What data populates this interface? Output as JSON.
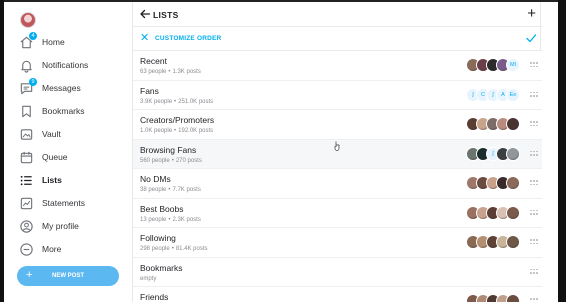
{
  "sidebar": {
    "items": [
      {
        "label": "Home",
        "icon": "home-icon",
        "badge": "4"
      },
      {
        "label": "Notifications",
        "icon": "bell-icon",
        "badge": ""
      },
      {
        "label": "Messages",
        "icon": "chat-icon",
        "badge": "9"
      },
      {
        "label": "Bookmarks",
        "icon": "bookmark-icon",
        "badge": ""
      },
      {
        "label": "Vault",
        "icon": "vault-icon",
        "badge": ""
      },
      {
        "label": "Queue",
        "icon": "calendar-icon",
        "badge": ""
      },
      {
        "label": "Lists",
        "icon": "list-icon",
        "badge": ""
      },
      {
        "label": "Statements",
        "icon": "chart-icon",
        "badge": ""
      },
      {
        "label": "My profile",
        "icon": "profile-icon",
        "badge": ""
      },
      {
        "label": "More",
        "icon": "more-icon",
        "badge": ""
      }
    ],
    "new_post_label": "NEW POST"
  },
  "header": {
    "title": "LISTS"
  },
  "customize": {
    "label": "CUSTOMIZE ORDER"
  },
  "lists": [
    {
      "name": "Recent",
      "people": "63 people",
      "posts": "1.3K posts",
      "avatars": [
        "#8a6b5a",
        "#6b3f4a",
        "#2b2b2b",
        "#7a5c8a",
        "MI"
      ]
    },
    {
      "name": "Fans",
      "people": "3.9K people",
      "posts": "251.0K posts",
      "avatars": [
        "ʃ",
        "C",
        "ʃ",
        "A",
        "Ee"
      ]
    },
    {
      "name": "Creators/Promoters",
      "people": "1.0K people",
      "posts": "192.0K posts",
      "avatars": [
        "#5a3d33",
        "#c9a48a",
        "#7d6d6a",
        "#b98a7e",
        "#4a3431"
      ]
    },
    {
      "name": "Browsing Fans",
      "people": "560 people",
      "posts": "270 posts",
      "avatars": [
        "#6b7570",
        "#1a2d2a",
        "ʃ",
        "#3c3f42",
        "#8f969c"
      ]
    },
    {
      "name": "No DMs",
      "people": "38 people",
      "posts": "7.7K posts",
      "avatars": [
        "#a0786a",
        "#6b4b40",
        "#c9a08a",
        "#3a2a2a",
        "#8c6a5a"
      ]
    },
    {
      "name": "Best Boobs",
      "people": "13 people",
      "posts": "2.3K posts",
      "avatars": [
        "#9a7060",
        "#c8a28f",
        "#5b3d35",
        "#d8c0b5",
        "#7a5a4a"
      ]
    },
    {
      "name": "Following",
      "people": "298 people",
      "posts": "81.4K posts",
      "avatars": [
        "#8b6a55",
        "#b48e70",
        "#5e4236",
        "#c8b49a",
        "#6f5848"
      ]
    },
    {
      "name": "Bookmarks",
      "people": "empty",
      "posts": "",
      "avatars": []
    },
    {
      "name": "Friends",
      "people": "",
      "posts": "",
      "avatars": [
        "#7d5a4c",
        "#b08a74",
        "#4d3a33",
        "#c0a08c",
        "#6a4d40"
      ]
    }
  ],
  "colors": {
    "accent": "#00aff0",
    "new_post_bg": "#5cb8f0"
  }
}
